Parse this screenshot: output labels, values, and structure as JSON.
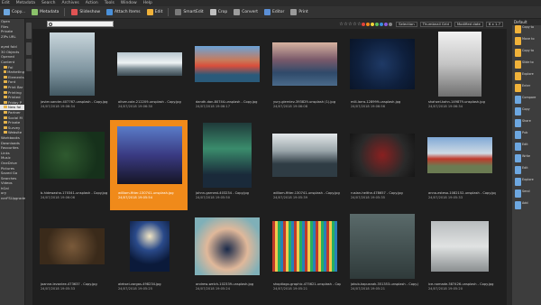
{
  "menu": [
    "Edit",
    "Metadata",
    "Search",
    "Archives",
    "Action",
    "Tools",
    "Window",
    "Help"
  ],
  "toolbar": [
    {
      "label": "Copy...",
      "color": "#6da7e0"
    },
    {
      "label": "Metadata",
      "color": "#8bc26a"
    },
    {
      "label": "Slideshow",
      "color": "#e05353"
    },
    {
      "label": "Attach Items",
      "color": "#4a90d9"
    },
    {
      "label": "Edit",
      "color": "#f0b23a"
    },
    {
      "label": "SmartEdit",
      "color": "#7a7a7a"
    },
    {
      "label": "Crop",
      "color": "#c0c0c0"
    },
    {
      "label": "Convert",
      "color": "#9c9c9c"
    },
    {
      "label": "Editor",
      "color": "#5b8fd6"
    },
    {
      "label": "Print",
      "color": "#9a9a9a"
    }
  ],
  "left_tree": [
    "Open",
    "Files",
    "Private",
    "ZIPs URL",
    "",
    "ayed fold",
    "30 Objects",
    "Opened",
    "Content",
    "Fol",
    "Marketing",
    "Elements",
    "Font",
    "Print Bar",
    "Printing",
    "Printed",
    "Friday P",
    "New fol",
    "Partner",
    "Social M",
    "Private",
    "Survey",
    "Website",
    "Workbooks",
    "Downloads",
    "Favourites",
    "Links",
    "Music",
    "OneDrive",
    "Pictures",
    "Saved Ga",
    "Searches",
    "Videos",
    "hGal",
    "ory",
    "nerFSUpgrade"
  ],
  "filterbar": {
    "stars": [
      "☆",
      "☆",
      "☆",
      "☆",
      "☆"
    ],
    "color_tags": [
      "#e0433b",
      "#f08a1a",
      "#f2d23a",
      "#5ec05a",
      "#3a8ee0",
      "#8a5ce0",
      "#888888"
    ],
    "selection_label": "Selection",
    "view_label": "Thumbnail Grid",
    "sort_label": "Modified date",
    "size_label": "6 x 1.7"
  },
  "thumbnails": [
    {
      "name": "javier-sander-407767-unsplash - Copy.jpg",
      "date": "24/07/2018 19:06:34",
      "selected": false
    },
    {
      "name": "oliver-cole-212209-unsplash - Copy.jpg",
      "date": "24/07/2018 19:06:30",
      "selected": false
    },
    {
      "name": "dandh-dan-80744-unsplash - Copy.jpg",
      "date": "24/07/2018 19:06:17",
      "selected": false
    },
    {
      "name": "yury-gierniev-393829-unsplash (1).jpg",
      "date": "24/07/2018 19:06:08",
      "selected": false
    },
    {
      "name": "mili-larra-128999-unsplash.jpg",
      "date": "24/07/2018 19:06:56",
      "selected": false
    },
    {
      "name": "shahzel-kahn-149879-unsplash.jpg",
      "date": "24/07/2018 19:06:34",
      "selected": false
    },
    {
      "name": "b-hidewasha-170341-unsplash - Copy.jpg",
      "date": "24/07/2018 19:06:06",
      "selected": false
    },
    {
      "name": "william-fitter-130741-unsplash.jpg",
      "date": "24/07/2018 19:05:54",
      "selected": true
    },
    {
      "name": "johnn-garnest-403234 - Copy.jpg",
      "date": "24/07/2018 19:05:50",
      "selected": false
    },
    {
      "name": "william-fitter-130741-unsplash - Copy.jpg",
      "date": "24/07/2018 19:05:39",
      "selected": false
    },
    {
      "name": "ruslan-helthe-478657 - Copy.jpg",
      "date": "24/07/2018 19:05:35",
      "selected": false
    },
    {
      "name": "anna-esteso-1082152-unsplash - Copy.jpg",
      "date": "24/07/2018 19:05:33",
      "selected": false
    },
    {
      "name": "joanne-levanlee-473637 - Copy.jpg",
      "date": "24/07/2018 19:05:33",
      "selected": false
    },
    {
      "name": "aleksei-vargas-498234.jpg",
      "date": "24/07/2018 19:05:25",
      "selected": false
    },
    {
      "name": "andrew-welch-102339-unsplash.jpg",
      "date": "24/07/2018 19:05:24",
      "selected": false
    },
    {
      "name": "shoptiago-graphic-475621-unsplash - Copy.jpg",
      "date": "24/07/2018 19:05:21",
      "selected": false
    },
    {
      "name": "jakub-kapusnak-351353-unsplash - Copy.jpg",
      "date": "24/07/2018 19:05:21",
      "selected": false
    },
    {
      "name": "ice-nomade-587426-unsplash - Copy.jpg",
      "date": "24/07/2018 19:05:20",
      "selected": false
    }
  ],
  "right_panel": {
    "header": "Default",
    "items": [
      "Copy to",
      "Move to",
      "Copy to",
      "Slide to",
      "Explore",
      "Enter",
      "Compare",
      "Copy",
      "Share",
      "Pub",
      "Edit",
      "Write",
      "Edit",
      "Explore",
      "Send",
      "Add"
    ]
  }
}
